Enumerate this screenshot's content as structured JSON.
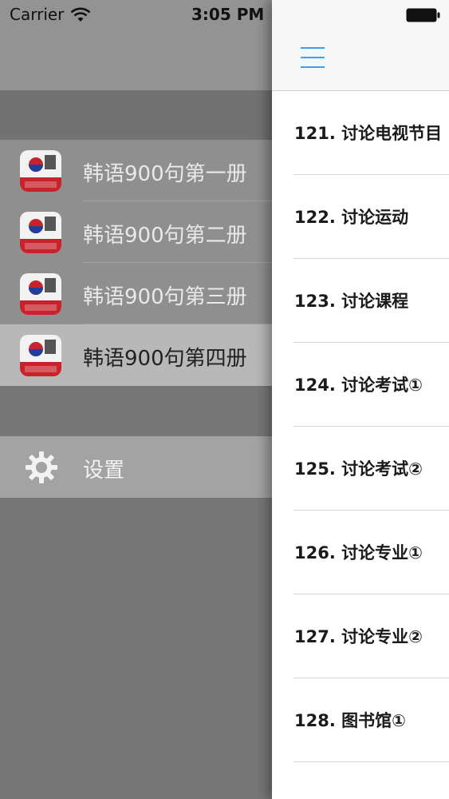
{
  "status_bar": {
    "carrier": "Carrier",
    "time": "3:05 PM",
    "icons": [
      "wifi-icon",
      "battery-icon"
    ]
  },
  "menu": {
    "books": [
      {
        "label": "韩语900句第一册",
        "icon": "book-cover-icon",
        "selected": false
      },
      {
        "label": "韩语900句第二册",
        "icon": "book-cover-icon",
        "selected": false
      },
      {
        "label": "韩语900句第三册",
        "icon": "book-cover-icon",
        "selected": false
      },
      {
        "label": "韩语900句第四册",
        "icon": "book-cover-icon",
        "selected": true
      }
    ],
    "settings": {
      "label": "设置",
      "icon": "gear-icon"
    }
  },
  "main": {
    "nav_icon": "hamburger-menu-icon",
    "lessons": [
      "121. 讨论电视节目",
      "122. 讨论运动",
      "123. 讨论课程",
      "124. 讨论考试①",
      "125. 讨论考试②",
      "126. 讨论专业①",
      "127. 讨论专业②",
      "128. 图书馆①"
    ]
  },
  "colors": {
    "accent": "#3a9ff0",
    "menu_background": "#777777",
    "menu_selected": "#b8b8b8",
    "book_cover_red": "#c8232c"
  }
}
